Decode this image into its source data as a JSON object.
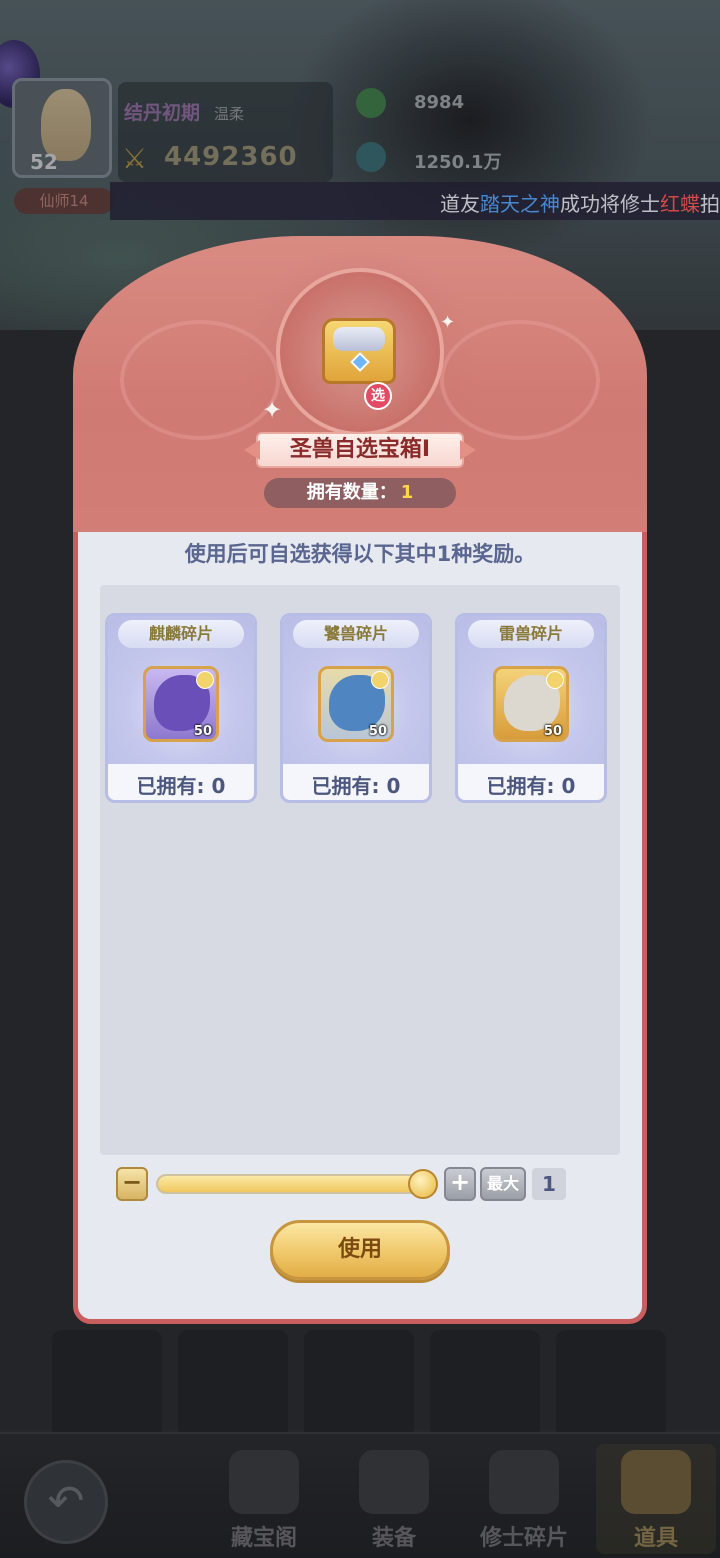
{
  "hud": {
    "player_level": "52",
    "realm": "结丹初期",
    "trait": "温柔",
    "power": "4492360",
    "resource_1": "8984",
    "resource_2": "1250.1万",
    "title_badge": "仙师14"
  },
  "marquee": {
    "prefix": "道友",
    "name_1": "踏天之神",
    "middle": "成功将修士",
    "name_2": "红蝶",
    "suffix": "拍",
    "highlight_color_1": "#58a6ff",
    "highlight_color_2": "#ff5a5a"
  },
  "dialog": {
    "item_name": "圣兽自选宝箱Ⅰ",
    "chest_badge": "选",
    "owned_label": "拥有数量：",
    "owned_count": "1",
    "description": "使用后可自选获得以下其中1种奖励。",
    "rewards": [
      {
        "name": "麒麟碎片",
        "quantity": "50",
        "owned": "已拥有: 0",
        "creature_color": "#7a63c8",
        "icon": "qilin-fragment-icon"
      },
      {
        "name": "饕兽碎片",
        "quantity": "50",
        "owned": "已拥有: 0",
        "creature_color": "#5b8fc6",
        "icon": "taotie-fragment-icon"
      },
      {
        "name": "雷兽碎片",
        "quantity": "50",
        "owned": "已拥有: 0",
        "creature_color": "#d7d2c8",
        "icon": "thunder-beast-fragment-icon"
      }
    ],
    "stepper": {
      "minus": "−",
      "plus": "+",
      "max_label": "最大",
      "value": "1",
      "slider_fraction": 1.0
    },
    "use_label": "使用",
    "accent_color": "#c85e5e"
  },
  "bottom_nav": {
    "back_icon": "back-arrow-icon",
    "tabs": [
      {
        "label": "藏宝阁",
        "active": false
      },
      {
        "label": "装备",
        "active": false
      },
      {
        "label": "修士碎片",
        "active": false
      },
      {
        "label": "道具",
        "active": true
      }
    ]
  }
}
